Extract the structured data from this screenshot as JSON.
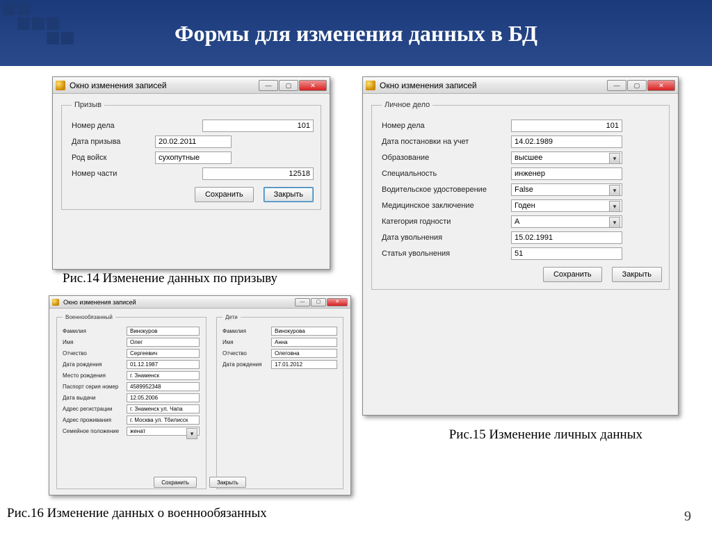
{
  "slide": {
    "title": "Формы для изменения данных в БД",
    "page_number": "9"
  },
  "captions": {
    "fig14": "Рис.14 Изменение  данных по призыву",
    "fig15": "Рис.15 Изменение личных данных",
    "fig16": "Рис.16 Изменение  данных о военнообязанных"
  },
  "window_common": {
    "title": "Окно изменения записей",
    "save": "Сохранить",
    "close": "Закрыть"
  },
  "win1": {
    "group": "Призыв",
    "fields": {
      "case_no": {
        "label": "Номер дела",
        "value": "101"
      },
      "draft_date": {
        "label": "Дата призыва",
        "value": "20.02.2011"
      },
      "branch": {
        "label": "Род войск",
        "value": "сухопутные"
      },
      "unit_no": {
        "label": "Номер части",
        "value": "12518"
      }
    }
  },
  "win2": {
    "group": "Личное дело",
    "fields": {
      "case_no": {
        "label": "Номер дела",
        "value": "101"
      },
      "reg_date": {
        "label": "Дата постановки на учет",
        "value": "14.02.1989"
      },
      "education": {
        "label": "Образование",
        "value": "высшее"
      },
      "specialty": {
        "label": "Специальность",
        "value": "инженер"
      },
      "driver": {
        "label": "Водительское удостоверение",
        "value": "False"
      },
      "med": {
        "label": "Медицинское заключение",
        "value": "Годен"
      },
      "category": {
        "label": "Категория годности",
        "value": "А"
      },
      "discharge_date": {
        "label": "Дата увольнения",
        "value": "15.02.1991"
      },
      "discharge_article": {
        "label": "Статья увольнения",
        "value": "51"
      }
    }
  },
  "win3": {
    "group1": "Военнообязанный",
    "group2": "Дети",
    "person": {
      "surname": {
        "label": "Фамилия",
        "value": "Винокуров"
      },
      "name": {
        "label": "Имя",
        "value": "Олег"
      },
      "patronymic": {
        "label": "Отчество",
        "value": "Сергеевич"
      },
      "birth_date": {
        "label": "Дата рождения",
        "value": "01.12.1987"
      },
      "birth_place": {
        "label": "Место рождения",
        "value": "г. Знаменск"
      },
      "passport": {
        "label": "Паспорт серия номер",
        "value": "4589952348"
      },
      "issue_date": {
        "label": "Дата выдачи",
        "value": "12.05.2006"
      },
      "reg_addr": {
        "label": "Адрес регистрации",
        "value": "г. Знаменск ул. Чапа"
      },
      "live_addr": {
        "label": "Адрес проживания",
        "value": "г. Москва ул. Тбилисск"
      },
      "marital": {
        "label": "Семейное положение",
        "value": "женат"
      }
    },
    "child": {
      "surname": {
        "label": "Фамилия",
        "value": "Винокурова"
      },
      "name": {
        "label": "Имя",
        "value": "Анна"
      },
      "patronymic": {
        "label": "Отчество",
        "value": "Олеговна"
      },
      "birth_date": {
        "label": "Дата рождения",
        "value": "17.01.2012"
      }
    }
  }
}
